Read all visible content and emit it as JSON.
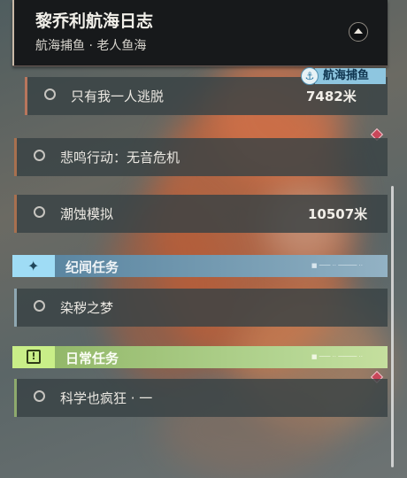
{
  "header": {
    "title": "黎乔利航海日志",
    "subtitle": "航海捕鱼 · 老人鱼海"
  },
  "tag": {
    "label": "航海捕鱼",
    "icon": "anchor-icon"
  },
  "tasks": [
    {
      "name": "只有我一人逃脱",
      "distance": "7482米"
    },
    {
      "name": "悲鸣行动：无音危机",
      "distance": ""
    },
    {
      "name": "潮蚀模拟",
      "distance": "10507米"
    },
    {
      "name": "染秽之梦",
      "distance": ""
    },
    {
      "name": "科学也疯狂 · 一",
      "distance": ""
    }
  ],
  "categories": [
    {
      "label": "纪闻任务",
      "icon": "sparkle-icon",
      "color": "#9fdcf5"
    },
    {
      "label": "日常任务",
      "icon": "alert-icon",
      "color": "#c9ee88"
    }
  ],
  "colors": {
    "tracked_task": "#b8765d",
    "side_task": "#8fa7b2",
    "daily_task": "#8eaa6d",
    "marker": "#c9475a"
  }
}
